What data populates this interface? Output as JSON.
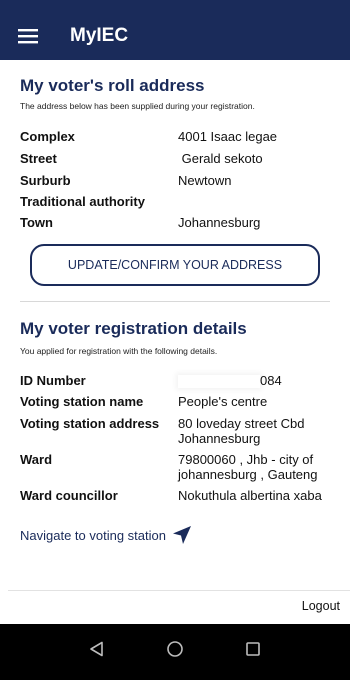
{
  "app_bar": {
    "title": "MyIEC",
    "menu_icon": "hamburger-menu-icon",
    "background": "#1a2b5a"
  },
  "roll_address": {
    "title": "My voter's roll address",
    "subtitle": "The address below has been supplied during your registration.",
    "fields": [
      {
        "label": "Complex",
        "value": "4001 Isaac legae"
      },
      {
        "label": "Street",
        "value": " Gerald sekoto"
      },
      {
        "label": "Surburb",
        "value": "Newtown"
      },
      {
        "label": "Traditional authority",
        "value": ""
      },
      {
        "label": "Town",
        "value": "Johannesburg"
      }
    ],
    "confirm_button": "UPDATE/CONFIRM YOUR ADDRESS"
  },
  "registration": {
    "title": "My voter registration details",
    "subtitle": "You applied for registration with the following details.",
    "id_label": "ID Number",
    "id_value_visible": "084",
    "fields": [
      {
        "label": "Voting station name",
        "value": "People's centre"
      },
      {
        "label": "Voting station address",
        "value": "80 loveday street Cbd Johannesburg"
      },
      {
        "label": "Ward",
        "value": "79800060 , Jhb - city of johannesburg , Gauteng"
      },
      {
        "label": "Ward councillor",
        "value": "Nokuthula albertina xaba"
      }
    ]
  },
  "navigate_link": {
    "label": "Navigate to voting station",
    "icon": "navigation-arrow-icon"
  },
  "logout_label": "Logout",
  "system_nav": {
    "back_icon": "back-triangle-icon",
    "home_icon": "home-circle-icon",
    "recents_icon": "recents-square-icon"
  }
}
